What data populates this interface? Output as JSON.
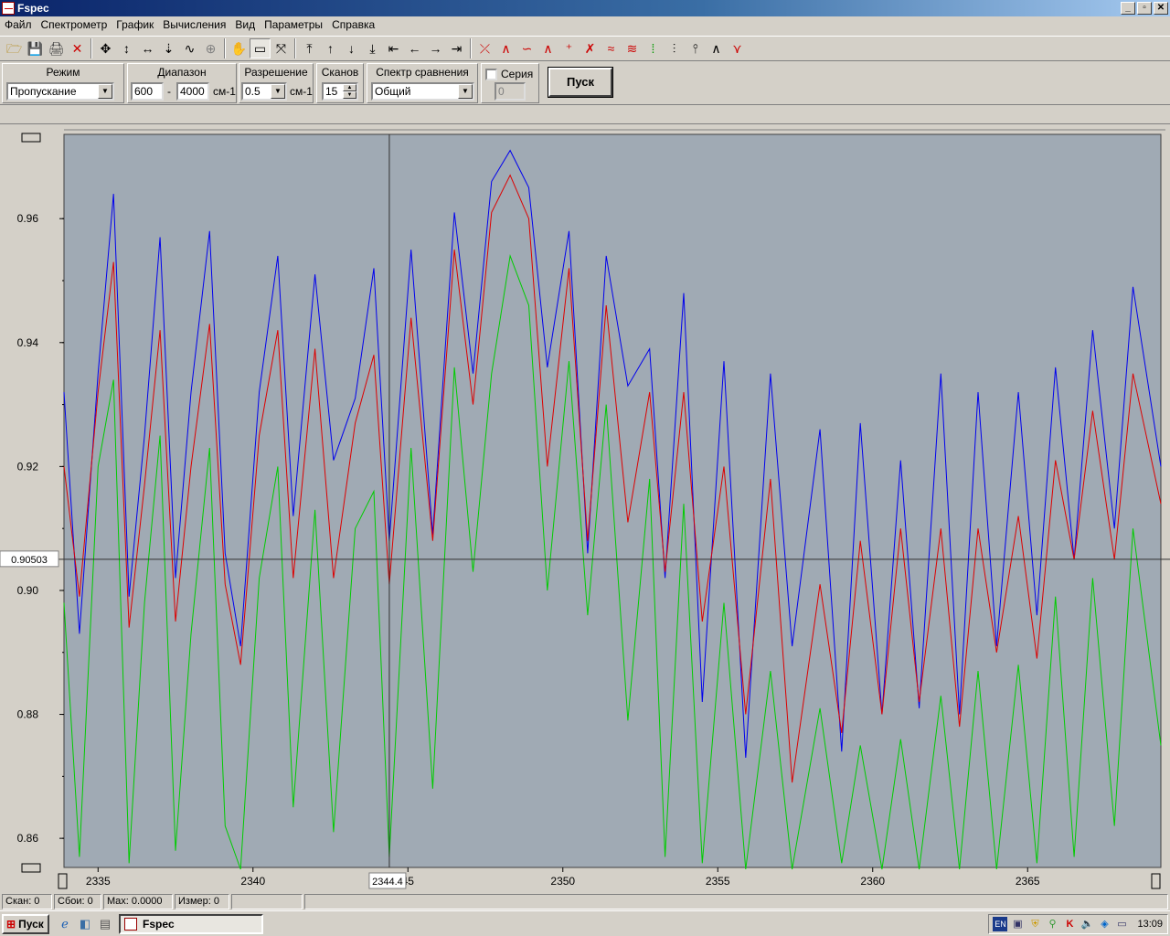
{
  "window": {
    "title": "Fspec",
    "min": "_",
    "max": "▫",
    "close": "✕"
  },
  "menu": [
    "Файл",
    "Спектрометр",
    "График",
    "Вычисления",
    "Вид",
    "Параметры",
    "Справка"
  ],
  "toolbar": {
    "icons": [
      "open-icon",
      "save-icon",
      "print-icon",
      "delete-icon",
      "sep",
      "move-icon",
      "stretch-vertical-icon",
      "stretch-horizontal-icon",
      "peak-down-icon",
      "peak-icon",
      "zoom-icon",
      "sep",
      "pan-hand-icon",
      "select-rect-icon",
      "autoscale-icon",
      "sep",
      "scroll-top-icon",
      "scroll-up-icon",
      "scroll-down-icon",
      "scroll-bottom-icon",
      "scroll-leftmost-icon",
      "scroll-left-icon",
      "scroll-right-icon",
      "scroll-rightmost-icon",
      "sep",
      "baseline-icon",
      "spectrum-tool-1-icon",
      "spectrum-tool-2-icon",
      "spectrum-tool-3-icon",
      "spectrum-tool-4-icon",
      "spectrum-tool-5-icon",
      "spectrum-tool-6-icon",
      "spectrum-tool-7-icon",
      "spectrum-tool-8-icon",
      "spectrum-tool-9-icon",
      "spectrum-tool-10-icon",
      "spectrum-tool-11-icon",
      "spectrum-tool-12-icon",
      "spectrum-tool-13-icon"
    ],
    "glyphs": [
      "🗁",
      "💾",
      "🖨",
      "✕",
      "",
      "✥",
      "↕",
      "↔",
      "⇣",
      "∿",
      "⊕",
      "",
      "✋",
      "▭",
      "⤧",
      "",
      "⤒",
      "↑",
      "↓",
      "⤓",
      "⇤",
      "←",
      "→",
      "⇥",
      "",
      "⤫",
      "∧",
      "∽",
      "∧",
      "⁺",
      "✗",
      "≈",
      "≋",
      "⁞",
      "⫶",
      "⫯",
      "∧",
      "⋎"
    ],
    "colors": [
      "#b08000",
      "#000080",
      "#404040",
      "#cc0000",
      "",
      "#000",
      "#000",
      "#000",
      "#000",
      "#000",
      "#808080",
      "",
      "#000",
      "#000",
      "#000",
      "",
      "#000",
      "#000",
      "#000",
      "#000",
      "#000",
      "#000",
      "#000",
      "#000",
      "",
      "#c00",
      "#c00",
      "#c00",
      "#c00",
      "#c00",
      "#c00",
      "#c00",
      "#c00",
      "#090",
      "#000",
      "#000",
      "#000",
      "#c00",
      "#000"
    ]
  },
  "params": {
    "mode": {
      "label": "Режим",
      "value": "Пропускание"
    },
    "range": {
      "label": "Диапазон",
      "from": "600",
      "dash": "-",
      "to": "4000",
      "unit": "см-1"
    },
    "resolution": {
      "label": "Разрешение",
      "value": "0.5",
      "unit": "см-1"
    },
    "scans": {
      "label": "Сканов",
      "value": "15"
    },
    "compare": {
      "label": "Спектр сравнения",
      "value": "Общий"
    },
    "series": {
      "label": "Серия",
      "value": "0",
      "checked": false
    },
    "start_label": "Пуск"
  },
  "chart_data": {
    "type": "line",
    "xlim": [
      2333.9,
      2369.3
    ],
    "ylim": [
      0.8553,
      0.9736
    ],
    "x_ticks": [
      2335,
      2340,
      2345,
      2350,
      2355,
      2360,
      2365
    ],
    "x_tick_labels": [
      "2335",
      "2340",
      "45",
      "2350",
      "2355",
      "2360",
      "2365"
    ],
    "y_ticks": [
      0.86,
      0.88,
      0.9,
      0.92,
      0.94,
      0.96
    ],
    "y_tick_labels": [
      "0.86",
      "0.88",
      "0.90",
      "0.92",
      "0.94",
      "0.96"
    ],
    "cursor": {
      "x": 2344.4,
      "y": 0.90503,
      "x_label": "2344.4",
      "y_label": "0.90503"
    },
    "background": "#a0aab4",
    "series": [
      {
        "color": "#0000ee",
        "points": [
          [
            2333.9,
            0.932
          ],
          [
            2334.4,
            0.893
          ],
          [
            2335.0,
            0.935
          ],
          [
            2335.5,
            0.964
          ],
          [
            2336.0,
            0.899
          ],
          [
            2336.5,
            0.925
          ],
          [
            2337.0,
            0.957
          ],
          [
            2337.5,
            0.902
          ],
          [
            2338.0,
            0.932
          ],
          [
            2338.6,
            0.958
          ],
          [
            2339.1,
            0.906
          ],
          [
            2339.6,
            0.891
          ],
          [
            2340.2,
            0.932
          ],
          [
            2340.8,
            0.954
          ],
          [
            2341.3,
            0.912
          ],
          [
            2342.0,
            0.951
          ],
          [
            2342.6,
            0.921
          ],
          [
            2343.3,
            0.931
          ],
          [
            2343.9,
            0.952
          ],
          [
            2344.4,
            0.908
          ],
          [
            2345.1,
            0.955
          ],
          [
            2345.8,
            0.909
          ],
          [
            2346.5,
            0.961
          ],
          [
            2347.1,
            0.935
          ],
          [
            2347.7,
            0.966
          ],
          [
            2348.3,
            0.971
          ],
          [
            2348.9,
            0.965
          ],
          [
            2349.5,
            0.936
          ],
          [
            2350.2,
            0.958
          ],
          [
            2350.8,
            0.906
          ],
          [
            2351.4,
            0.954
          ],
          [
            2352.1,
            0.933
          ],
          [
            2352.8,
            0.939
          ],
          [
            2353.3,
            0.902
          ],
          [
            2353.9,
            0.948
          ],
          [
            2354.5,
            0.882
          ],
          [
            2355.2,
            0.937
          ],
          [
            2355.9,
            0.873
          ],
          [
            2356.7,
            0.935
          ],
          [
            2357.4,
            0.891
          ],
          [
            2358.3,
            0.926
          ],
          [
            2359.0,
            0.874
          ],
          [
            2359.6,
            0.927
          ],
          [
            2360.3,
            0.88
          ],
          [
            2360.9,
            0.921
          ],
          [
            2361.5,
            0.881
          ],
          [
            2362.2,
            0.935
          ],
          [
            2362.8,
            0.88
          ],
          [
            2363.4,
            0.932
          ],
          [
            2364.0,
            0.891
          ],
          [
            2364.7,
            0.932
          ],
          [
            2365.3,
            0.896
          ],
          [
            2365.9,
            0.936
          ],
          [
            2366.5,
            0.905
          ],
          [
            2367.1,
            0.942
          ],
          [
            2367.8,
            0.91
          ],
          [
            2368.4,
            0.949
          ],
          [
            2369.3,
            0.92
          ]
        ]
      },
      {
        "color": "#dd0000",
        "points": [
          [
            2333.9,
            0.92
          ],
          [
            2334.4,
            0.899
          ],
          [
            2335.0,
            0.932
          ],
          [
            2335.5,
            0.953
          ],
          [
            2336.0,
            0.894
          ],
          [
            2336.5,
            0.917
          ],
          [
            2337.0,
            0.942
          ],
          [
            2337.5,
            0.895
          ],
          [
            2338.0,
            0.92
          ],
          [
            2338.6,
            0.943
          ],
          [
            2339.1,
            0.901
          ],
          [
            2339.6,
            0.888
          ],
          [
            2340.2,
            0.925
          ],
          [
            2340.8,
            0.942
          ],
          [
            2341.3,
            0.902
          ],
          [
            2342.0,
            0.939
          ],
          [
            2342.6,
            0.902
          ],
          [
            2343.3,
            0.927
          ],
          [
            2343.9,
            0.938
          ],
          [
            2344.4,
            0.901
          ],
          [
            2345.1,
            0.944
          ],
          [
            2345.8,
            0.908
          ],
          [
            2346.5,
            0.955
          ],
          [
            2347.1,
            0.93
          ],
          [
            2347.7,
            0.961
          ],
          [
            2348.3,
            0.967
          ],
          [
            2348.9,
            0.96
          ],
          [
            2349.5,
            0.92
          ],
          [
            2350.2,
            0.952
          ],
          [
            2350.8,
            0.908
          ],
          [
            2351.4,
            0.946
          ],
          [
            2352.1,
            0.911
          ],
          [
            2352.8,
            0.932
          ],
          [
            2353.3,
            0.903
          ],
          [
            2353.9,
            0.932
          ],
          [
            2354.5,
            0.895
          ],
          [
            2355.2,
            0.92
          ],
          [
            2355.9,
            0.88
          ],
          [
            2356.7,
            0.918
          ],
          [
            2357.4,
            0.869
          ],
          [
            2358.3,
            0.901
          ],
          [
            2359.0,
            0.877
          ],
          [
            2359.6,
            0.908
          ],
          [
            2360.3,
            0.88
          ],
          [
            2360.9,
            0.91
          ],
          [
            2361.5,
            0.882
          ],
          [
            2362.2,
            0.91
          ],
          [
            2362.8,
            0.878
          ],
          [
            2363.4,
            0.91
          ],
          [
            2364.0,
            0.89
          ],
          [
            2364.7,
            0.912
          ],
          [
            2365.3,
            0.889
          ],
          [
            2365.9,
            0.921
          ],
          [
            2366.5,
            0.905
          ],
          [
            2367.1,
            0.929
          ],
          [
            2367.8,
            0.905
          ],
          [
            2368.4,
            0.935
          ],
          [
            2369.3,
            0.914
          ]
        ]
      },
      {
        "color": "#00cc00",
        "points": [
          [
            2333.9,
            0.898
          ],
          [
            2334.4,
            0.857
          ],
          [
            2335.0,
            0.92
          ],
          [
            2335.5,
            0.934
          ],
          [
            2336.0,
            0.856
          ],
          [
            2336.5,
            0.898
          ],
          [
            2337.0,
            0.925
          ],
          [
            2337.5,
            0.858
          ],
          [
            2338.0,
            0.893
          ],
          [
            2338.6,
            0.923
          ],
          [
            2339.1,
            0.862
          ],
          [
            2339.6,
            0.855
          ],
          [
            2340.2,
            0.902
          ],
          [
            2340.8,
            0.92
          ],
          [
            2341.3,
            0.865
          ],
          [
            2342.0,
            0.913
          ],
          [
            2342.6,
            0.861
          ],
          [
            2343.3,
            0.91
          ],
          [
            2343.9,
            0.916
          ],
          [
            2344.4,
            0.857
          ],
          [
            2345.1,
            0.923
          ],
          [
            2345.8,
            0.868
          ],
          [
            2346.5,
            0.936
          ],
          [
            2347.1,
            0.903
          ],
          [
            2347.7,
            0.935
          ],
          [
            2348.3,
            0.954
          ],
          [
            2348.9,
            0.946
          ],
          [
            2349.5,
            0.9
          ],
          [
            2350.2,
            0.937
          ],
          [
            2350.8,
            0.896
          ],
          [
            2351.4,
            0.93
          ],
          [
            2352.1,
            0.879
          ],
          [
            2352.8,
            0.918
          ],
          [
            2353.3,
            0.857
          ],
          [
            2353.9,
            0.914
          ],
          [
            2354.5,
            0.856
          ],
          [
            2355.2,
            0.898
          ],
          [
            2355.9,
            0.855
          ],
          [
            2356.7,
            0.887
          ],
          [
            2357.4,
            0.855
          ],
          [
            2358.3,
            0.881
          ],
          [
            2359.0,
            0.856
          ],
          [
            2359.6,
            0.875
          ],
          [
            2360.3,
            0.855
          ],
          [
            2360.9,
            0.876
          ],
          [
            2361.5,
            0.855
          ],
          [
            2362.2,
            0.883
          ],
          [
            2362.8,
            0.855
          ],
          [
            2363.4,
            0.887
          ],
          [
            2364.0,
            0.855
          ],
          [
            2364.7,
            0.888
          ],
          [
            2365.3,
            0.856
          ],
          [
            2365.9,
            0.899
          ],
          [
            2366.5,
            0.857
          ],
          [
            2367.1,
            0.902
          ],
          [
            2367.8,
            0.862
          ],
          [
            2368.4,
            0.91
          ],
          [
            2369.3,
            0.875
          ]
        ]
      }
    ]
  },
  "status": {
    "scan": "Скан: 0",
    "failures": "Сбои: 0",
    "max": "Max: 0.0000",
    "measure": "Измер: 0"
  },
  "taskbar": {
    "start": "Пуск",
    "task": "Fspec",
    "lang": "EN",
    "clock": "13:09"
  }
}
